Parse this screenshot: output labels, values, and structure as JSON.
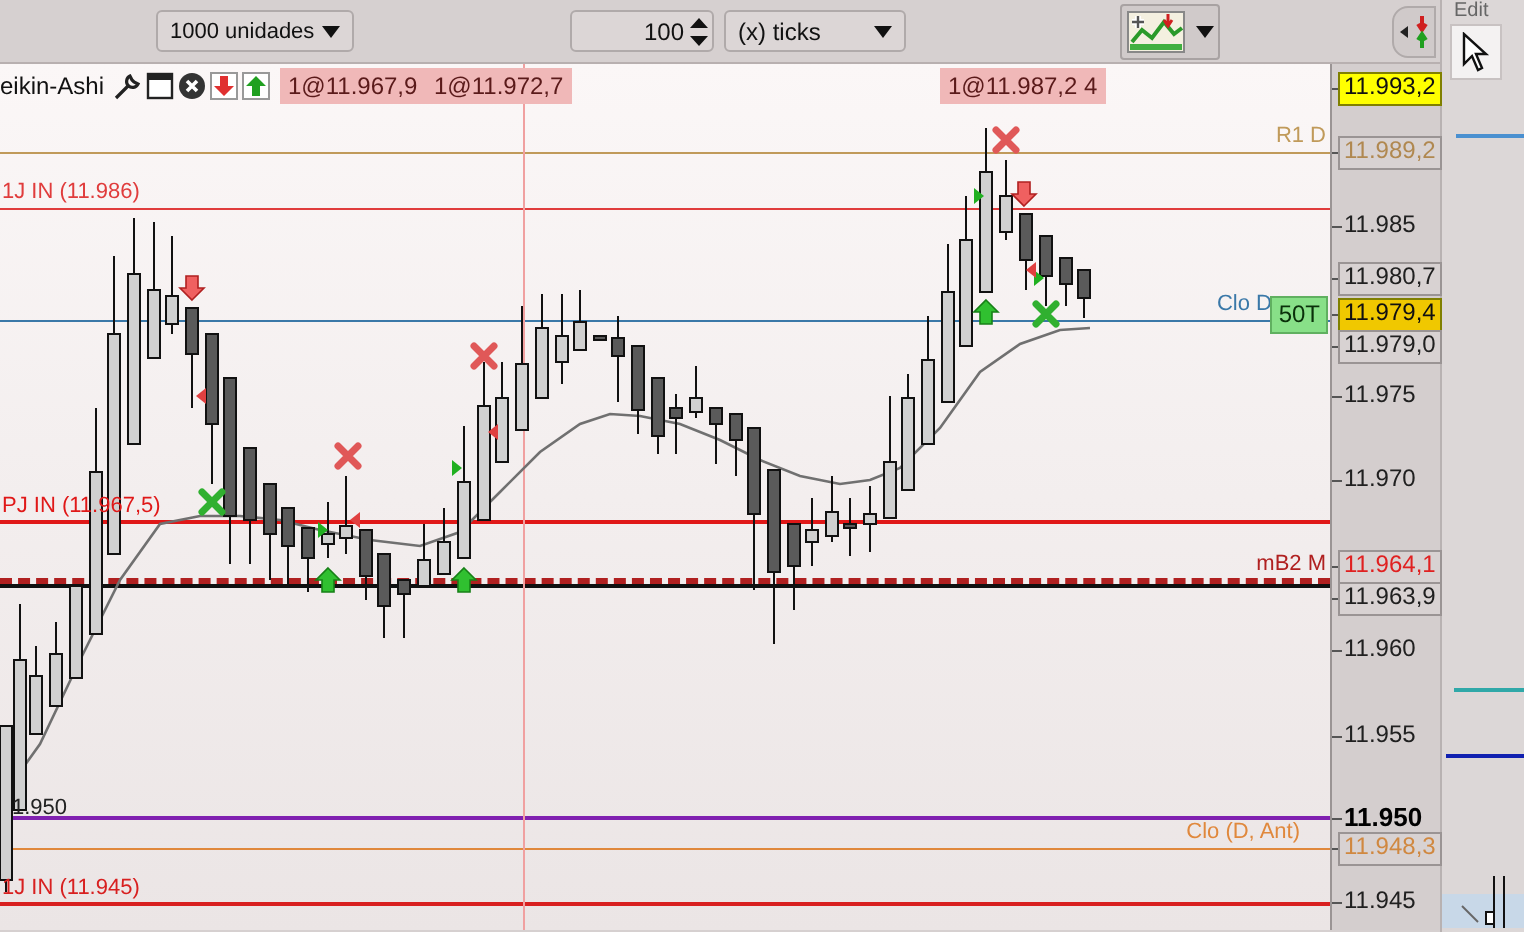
{
  "toolbar": {
    "quantity_dropdown": "1000 unidades",
    "interval_spinner": "100",
    "interval_unit_dropdown": "(x) ticks"
  },
  "side_panel": {
    "title": "Edit"
  },
  "chart": {
    "chart_type": "eikin-Ashi",
    "order_tags": [
      "1@11.967,9",
      "1@11.972,7",
      "1@11.987,2 4"
    ],
    "lines": [
      {
        "label": "R1 D",
        "kind": "thin",
        "color": "#c09a5a"
      },
      {
        "label": "1J IN (11.986)",
        "kind": "thin",
        "color": "#e03c3c"
      },
      {
        "label": "Clo D",
        "kind": "thin",
        "color": "#3a78a8"
      },
      {
        "label": "PJ IN (11.967,5)",
        "kind": "thick",
        "color": "#e01818"
      },
      {
        "label": "mB2 M",
        "kind": "dashed",
        "color": "#b02020"
      },
      {
        "kind": "thick",
        "color": "#101010"
      },
      {
        "kind": "thick",
        "color": "#8020b0"
      },
      {
        "label": "Clo (D, Ant)",
        "kind": "thin",
        "color": "#e0883c"
      },
      {
        "label": "1J IN (11.945)",
        "kind": "thick",
        "color": "#d82020"
      }
    ],
    "inline_price": "1.950",
    "position_tag": "50T",
    "price_axis": [
      {
        "text": "11.993,2",
        "kind": "highlight",
        "color": "#ffff00"
      },
      {
        "text": "11.989,2",
        "kind": "box",
        "color": "#b08850"
      },
      {
        "text": "11.985",
        "kind": "tick",
        "color": "#202020"
      },
      {
        "text": "11.980,7",
        "kind": "box",
        "color": "#202020"
      },
      {
        "text": "11.979,4",
        "kind": "highlight",
        "color": "#f0c800"
      },
      {
        "text": "11.979,0",
        "kind": "box",
        "color": "#202020"
      },
      {
        "text": "11.975",
        "kind": "tick",
        "color": "#202020"
      },
      {
        "text": "11.970",
        "kind": "tick",
        "color": "#202020"
      },
      {
        "text": "11.964,1",
        "kind": "box",
        "color": "#e02020"
      },
      {
        "text": "11.963,9",
        "kind": "box",
        "color": "#202020"
      },
      {
        "text": "11.960",
        "kind": "tick",
        "color": "#202020"
      },
      {
        "text": "11.955",
        "kind": "tick",
        "color": "#202020"
      },
      {
        "text": "11.950",
        "kind": "bold",
        "color": "#000000"
      },
      {
        "text": "11.948,3",
        "kind": "box",
        "color": "#d08840"
      },
      {
        "text": "11.945",
        "kind": "tick",
        "color": "#202020"
      }
    ]
  }
}
